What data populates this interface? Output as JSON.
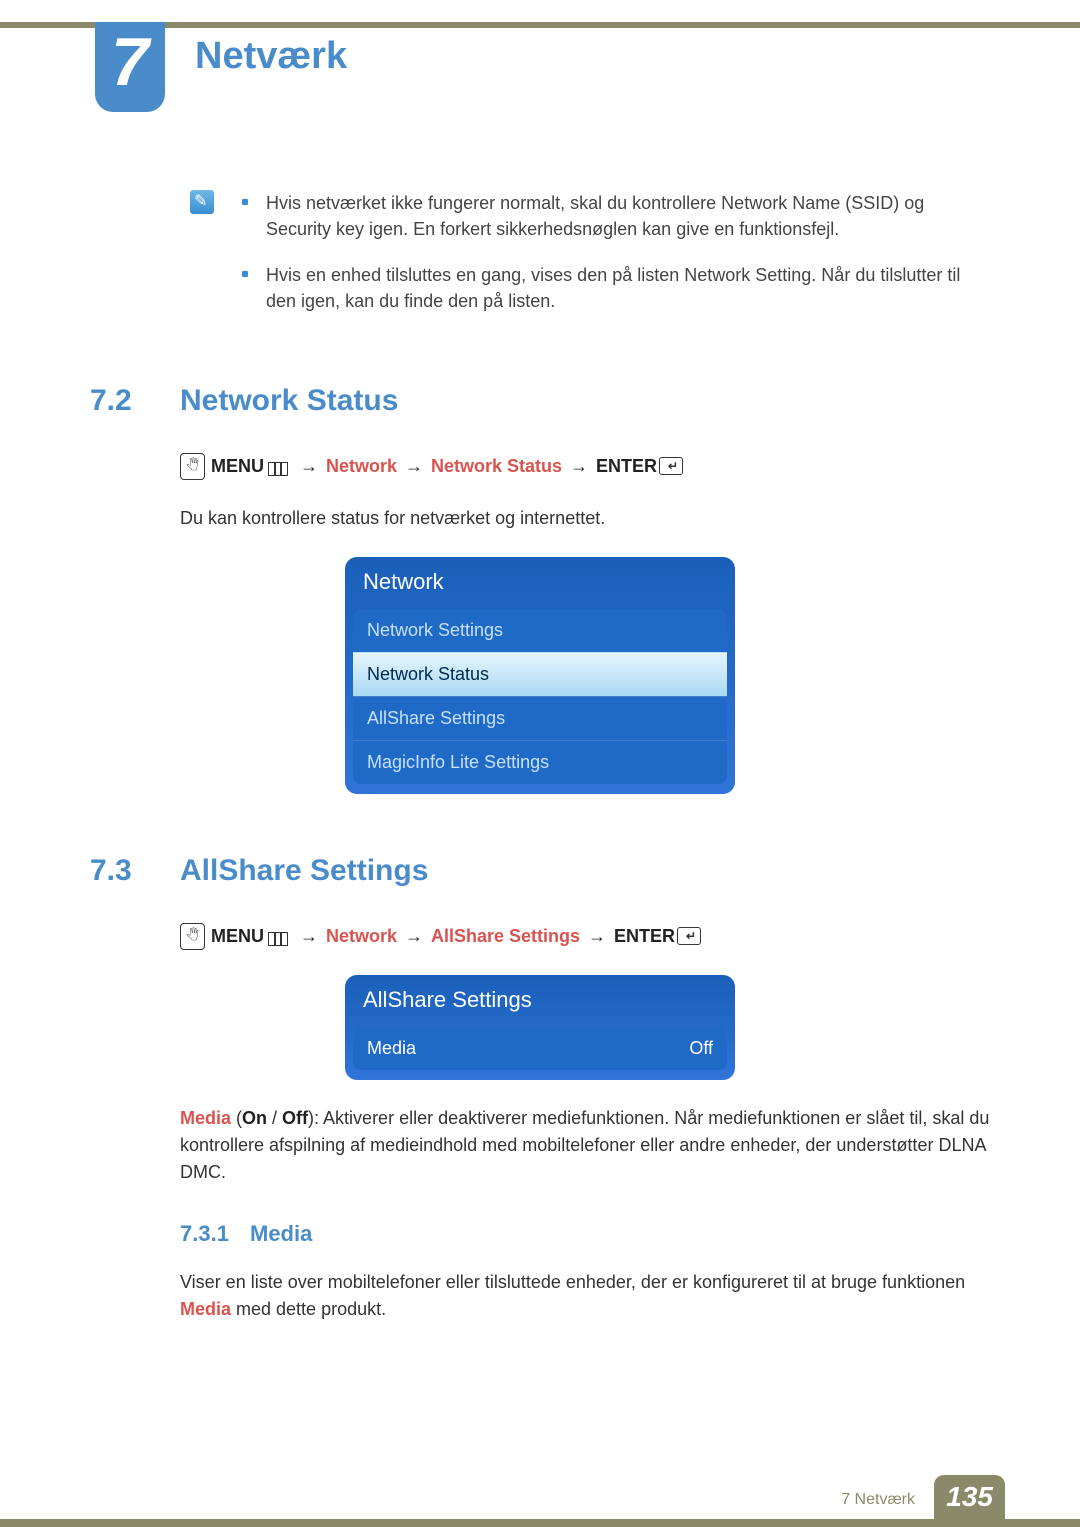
{
  "chapter": {
    "number": "7",
    "title": "Netværk"
  },
  "notes": {
    "items": [
      "Hvis netværket ikke fungerer normalt, skal du kontrollere Network Name (SSID) og Security key igen. En forkert sikkerhedsnøglen kan give en funktionsfejl.",
      "Hvis en enhed tilsluttes en gang, vises den på listen Network Setting. Når du tilslutter til den igen, kan du finde den på listen."
    ]
  },
  "section72": {
    "num": "7.2",
    "title": "Network Status",
    "breadcrumb": {
      "menu": "MENU",
      "p1": "Network",
      "p2": "Network Status",
      "enter": "ENTER"
    },
    "body": "Du kan kontrollere status for netværket og internettet.",
    "panel": {
      "title": "Network",
      "items": [
        {
          "label": "Network Settings",
          "selected": false
        },
        {
          "label": "Network Status",
          "selected": true
        },
        {
          "label": "AllShare Settings",
          "selected": false
        },
        {
          "label": "MagicInfo Lite Settings",
          "selected": false
        }
      ]
    }
  },
  "section73": {
    "num": "7.3",
    "title": "AllShare Settings",
    "breadcrumb": {
      "menu": "MENU",
      "p1": "Network",
      "p2": "AllShare Settings",
      "enter": "ENTER"
    },
    "panel": {
      "title": "AllShare Settings",
      "items": [
        {
          "label": "Media",
          "value": "Off"
        }
      ]
    },
    "body_parts": {
      "media": "Media",
      "paren_open": " (",
      "on": "On",
      "slash": " / ",
      "off": "Off",
      "paren_close": "): ",
      "rest": "Aktiverer eller deaktiverer mediefunktionen. Når mediefunktionen er slået til, skal du kontrollere afspilning af medieindhold med mobiltelefoner eller andre enheder, der understøtter DLNA DMC."
    },
    "sub": {
      "num": "7.3.1",
      "title": "Media",
      "body_pre": "Viser en liste over mobiltelefoner eller tilsluttede enheder, der er konfigureret til at bruge funktionen ",
      "body_red": "Media",
      "body_post": " med dette produkt."
    }
  },
  "footer": {
    "text": "7 Netværk",
    "page": "135"
  }
}
